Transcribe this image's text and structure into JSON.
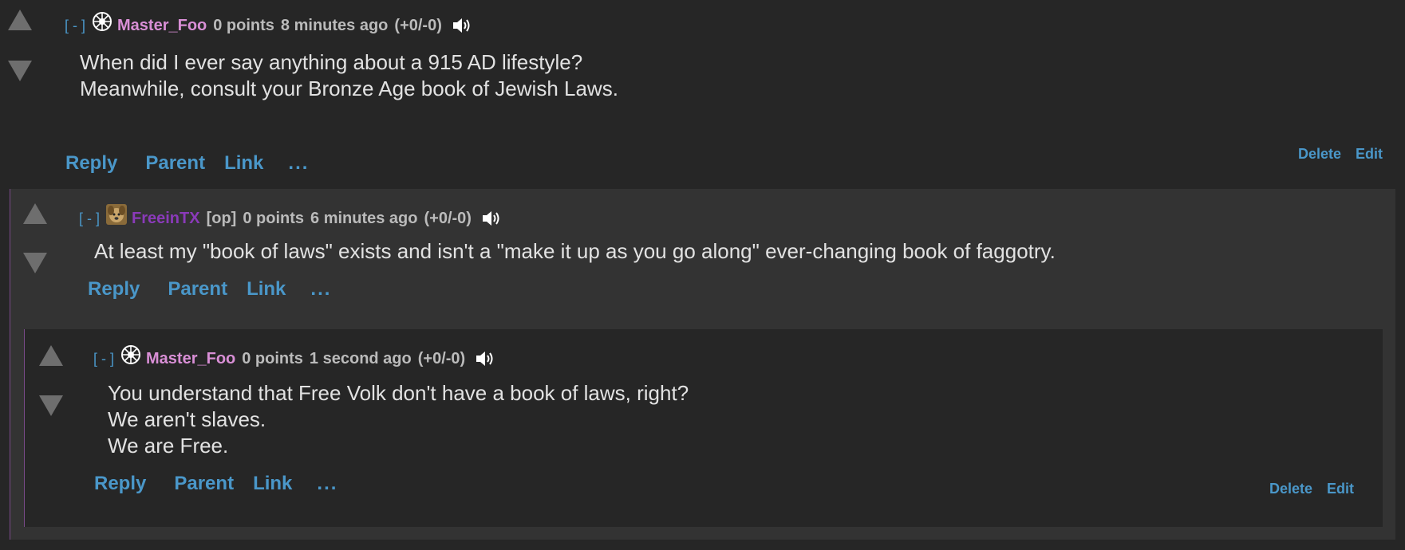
{
  "comments": [
    {
      "collapse": "[ - ]",
      "author": "Master_Foo",
      "flair": "",
      "score": "0 points",
      "time": "8 minutes ago",
      "tally": "(+0/-0)",
      "body": [
        "When did I ever say anything about a 915 AD lifestyle?",
        "Meanwhile, consult your Bronze Age book of Jewish Laws."
      ],
      "actions": {
        "reply": "Reply",
        "parent": "Parent",
        "link": "Link",
        "more": "..."
      },
      "owner_actions": {
        "delete": "Delete",
        "edit": "Edit"
      }
    },
    {
      "collapse": "[ - ]",
      "author": "FreeinTX",
      "flair": "[op]",
      "score": "0 points",
      "time": "6 minutes ago",
      "tally": "(+0/-0)",
      "body": [
        "At least my \"book of laws\" exists and isn't a \"make it up as you go along\" ever-changing book of faggotry."
      ],
      "actions": {
        "reply": "Reply",
        "parent": "Parent",
        "link": "Link",
        "more": "..."
      }
    },
    {
      "collapse": "[ - ]",
      "author": "Master_Foo",
      "flair": "",
      "score": "0 points",
      "time": "1 second ago",
      "tally": "(+0/-0)",
      "body": [
        "You understand that Free Volk don't have a book of laws, right?",
        "We aren't slaves.",
        "We are Free."
      ],
      "actions": {
        "reply": "Reply",
        "parent": "Parent",
        "link": "Link",
        "more": "..."
      },
      "owner_actions": {
        "delete": "Delete",
        "edit": "Edit"
      }
    }
  ],
  "colors": {
    "link": "#4a97c9",
    "author": "#d98fd6",
    "op_author": "#8a3ab9",
    "thread_line": "#7a4a8a"
  },
  "icons": {
    "upvote": "upvote-arrow-icon",
    "downvote": "downvote-arrow-icon",
    "audio": "speaker-icon",
    "avatar_1": "sun-wheel-icon",
    "avatar_2": "dog-avatar-icon"
  }
}
